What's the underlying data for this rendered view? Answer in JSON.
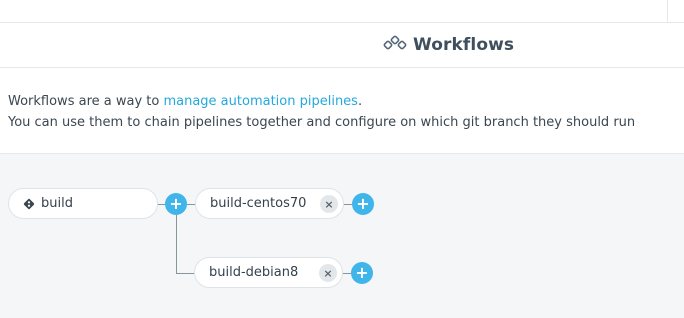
{
  "header": {
    "title": "Workflows",
    "icon": "workflow-icon"
  },
  "description": {
    "line1_prefix": "Workflows are a way to ",
    "line1_link": "manage automation pipelines",
    "line1_suffix": ".",
    "line2": "You can use them to chain pipelines together and configure on which git branch they should run"
  },
  "workflow": {
    "root": {
      "label": "build",
      "icon": "git-branch-icon"
    },
    "children": [
      {
        "label": "build-centos70",
        "remove_label": "×",
        "add_label": "+"
      },
      {
        "label": "build-debian8",
        "remove_label": "×",
        "add_label": "+"
      }
    ],
    "root_add_label": "+"
  },
  "colors": {
    "accent": "#3fb5ea",
    "link": "#23a9de",
    "canvas_bg": "#f5f6f7",
    "connector": "#8a949d"
  }
}
